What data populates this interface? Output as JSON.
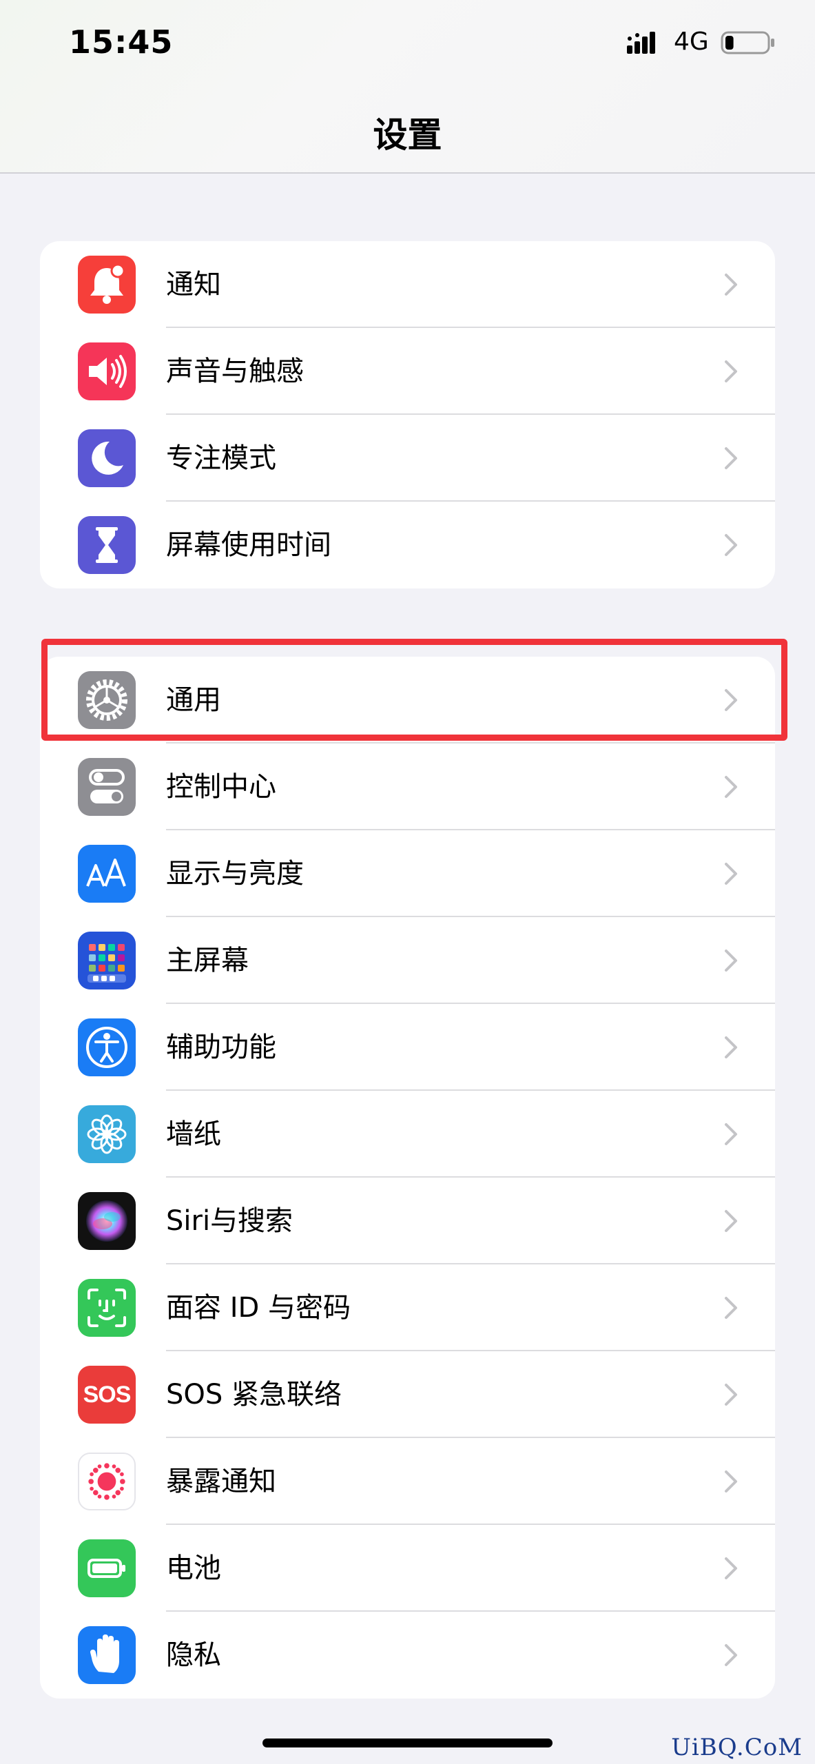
{
  "status_bar": {
    "time": "15:45",
    "network": "4G",
    "battery_level": 0.2
  },
  "nav": {
    "title": "设置"
  },
  "groups": [
    {
      "items": [
        {
          "label": "通知",
          "icon": "notification-bell-icon",
          "color": "#f63f3a"
        },
        {
          "label": "声音与触感",
          "icon": "speaker-icon",
          "color": "#f53558"
        },
        {
          "label": "专注模式",
          "icon": "moon-icon",
          "color": "#5b57d4"
        },
        {
          "label": "屏幕使用时间",
          "icon": "hourglass-icon",
          "color": "#5b57d4"
        }
      ]
    },
    {
      "items": [
        {
          "label": "通用",
          "icon": "gear-icon",
          "color": "#8e8e93"
        },
        {
          "label": "控制中心",
          "icon": "toggles-icon",
          "color": "#8e8e93"
        },
        {
          "label": "显示与亮度",
          "icon": "text-size-icon",
          "color": "#1a7cf5"
        },
        {
          "label": "主屏幕",
          "icon": "home-screen-grid-icon",
          "color": "#2553d8"
        },
        {
          "label": "辅助功能",
          "icon": "accessibility-icon",
          "color": "#1a7cf5"
        },
        {
          "label": "墙纸",
          "icon": "flower-icon",
          "color": "#37aadc"
        },
        {
          "label": "Siri与搜索",
          "icon": "siri-icon",
          "color": "#111111"
        },
        {
          "label": "面容 ID 与密码",
          "icon": "face-id-icon",
          "color": "#34c759"
        },
        {
          "label": "SOS 紧急联络",
          "icon": "sos-icon",
          "color": "#ea3c3a",
          "icon_text": "SOS"
        },
        {
          "label": "暴露通知",
          "icon": "exposure-icon",
          "color": "#ffffff"
        },
        {
          "label": "电池",
          "icon": "battery-icon",
          "color": "#34c759"
        },
        {
          "label": "隐私",
          "icon": "hand-icon",
          "color": "#1a7cf5"
        }
      ]
    }
  ],
  "watermark": "UiBQ.CoM"
}
